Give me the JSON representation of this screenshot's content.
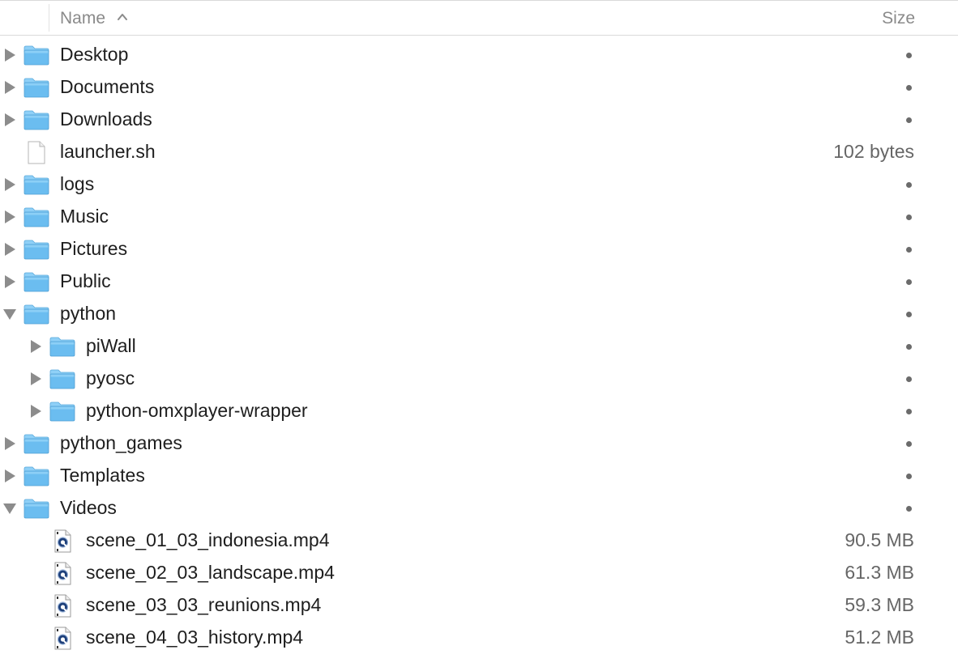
{
  "header": {
    "name_label": "Name",
    "size_label": "Size",
    "sort_direction": "ascending"
  },
  "colors": {
    "folder": "#6bbdf0",
    "folder_tab": "#8fd0f7",
    "disclosure": "#8c8c8c"
  },
  "rows": [
    {
      "name": "Desktop",
      "size": "--",
      "kind": "folder",
      "level": 0,
      "expandable": true,
      "expanded": false
    },
    {
      "name": "Documents",
      "size": "--",
      "kind": "folder",
      "level": 0,
      "expandable": true,
      "expanded": false
    },
    {
      "name": "Downloads",
      "size": "--",
      "kind": "folder",
      "level": 0,
      "expandable": true,
      "expanded": false
    },
    {
      "name": "launcher.sh",
      "size": "102 bytes",
      "kind": "file",
      "level": 0,
      "expandable": false,
      "expanded": false
    },
    {
      "name": "logs",
      "size": "--",
      "kind": "folder",
      "level": 0,
      "expandable": true,
      "expanded": false
    },
    {
      "name": "Music",
      "size": "--",
      "kind": "folder",
      "level": 0,
      "expandable": true,
      "expanded": false
    },
    {
      "name": "Pictures",
      "size": "--",
      "kind": "folder",
      "level": 0,
      "expandable": true,
      "expanded": false
    },
    {
      "name": "Public",
      "size": "--",
      "kind": "folder",
      "level": 0,
      "expandable": true,
      "expanded": false
    },
    {
      "name": "python",
      "size": "--",
      "kind": "folder",
      "level": 0,
      "expandable": true,
      "expanded": true
    },
    {
      "name": "piWall",
      "size": "--",
      "kind": "folder",
      "level": 1,
      "expandable": true,
      "expanded": false
    },
    {
      "name": "pyosc",
      "size": "--",
      "kind": "folder",
      "level": 1,
      "expandable": true,
      "expanded": false
    },
    {
      "name": "python-omxplayer-wrapper",
      "size": "--",
      "kind": "folder",
      "level": 1,
      "expandable": true,
      "expanded": false
    },
    {
      "name": "python_games",
      "size": "--",
      "kind": "folder",
      "level": 0,
      "expandable": true,
      "expanded": false
    },
    {
      "name": "Templates",
      "size": "--",
      "kind": "folder",
      "level": 0,
      "expandable": true,
      "expanded": false
    },
    {
      "name": "Videos",
      "size": "--",
      "kind": "folder",
      "level": 0,
      "expandable": true,
      "expanded": true
    },
    {
      "name": "scene_01_03_indonesia.mp4",
      "size": "90.5 MB",
      "kind": "video",
      "level": 1,
      "expandable": false,
      "expanded": false
    },
    {
      "name": "scene_02_03_landscape.mp4",
      "size": "61.3 MB",
      "kind": "video",
      "level": 1,
      "expandable": false,
      "expanded": false
    },
    {
      "name": "scene_03_03_reunions.mp4",
      "size": "59.3 MB",
      "kind": "video",
      "level": 1,
      "expandable": false,
      "expanded": false
    },
    {
      "name": "scene_04_03_history.mp4",
      "size": "51.2 MB",
      "kind": "video",
      "level": 1,
      "expandable": false,
      "expanded": false
    }
  ]
}
